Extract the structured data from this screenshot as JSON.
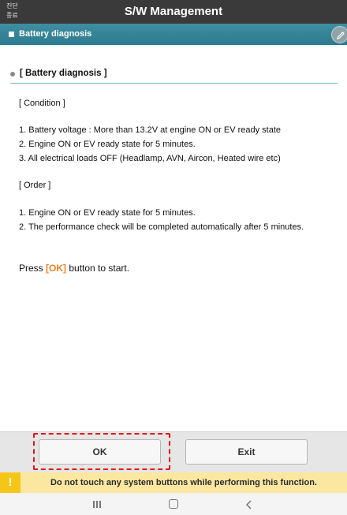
{
  "topbar": {
    "end_button_line1": "진단",
    "end_button_line2": "종료",
    "title": "S/W Management"
  },
  "section": {
    "title": "Battery diagnosis"
  },
  "content": {
    "header": "[ Battery diagnosis ]",
    "condition_label": "[ Condition ]",
    "conditions": [
      "1. Battery voltage : More than 13.2V at engine ON or EV ready state",
      "2. Engine ON or EV ready state for 5 minutes.",
      "3. All electrical loads OFF (Headlamp, AVN, Aircon, Heated wire etc)"
    ],
    "order_label": "[ Order ]",
    "orders": [
      "1. Engine ON or EV ready state for 5 minutes.",
      "2. The performance check will be completed automatically after 5 minutes."
    ],
    "press_prefix": "Press ",
    "press_ok": "[OK]",
    "press_suffix": " button to start."
  },
  "buttons": {
    "ok_label": "OK",
    "exit_label": "Exit"
  },
  "warning": {
    "icon": "!",
    "text": "Do not touch any system buttons while performing this function."
  },
  "icons": {
    "edit": "pencil-icon",
    "recent": "recent-apps-icon",
    "home": "home-icon",
    "back": "back-icon"
  },
  "colors": {
    "topbar": "#3a3a3a",
    "section_bar": "#2c7a8e",
    "ok_highlight": "#f0821f",
    "highlight_border": "#e0151c",
    "warning_bg": "#fbe7a0",
    "warning_icon_bg": "#f5c518"
  }
}
